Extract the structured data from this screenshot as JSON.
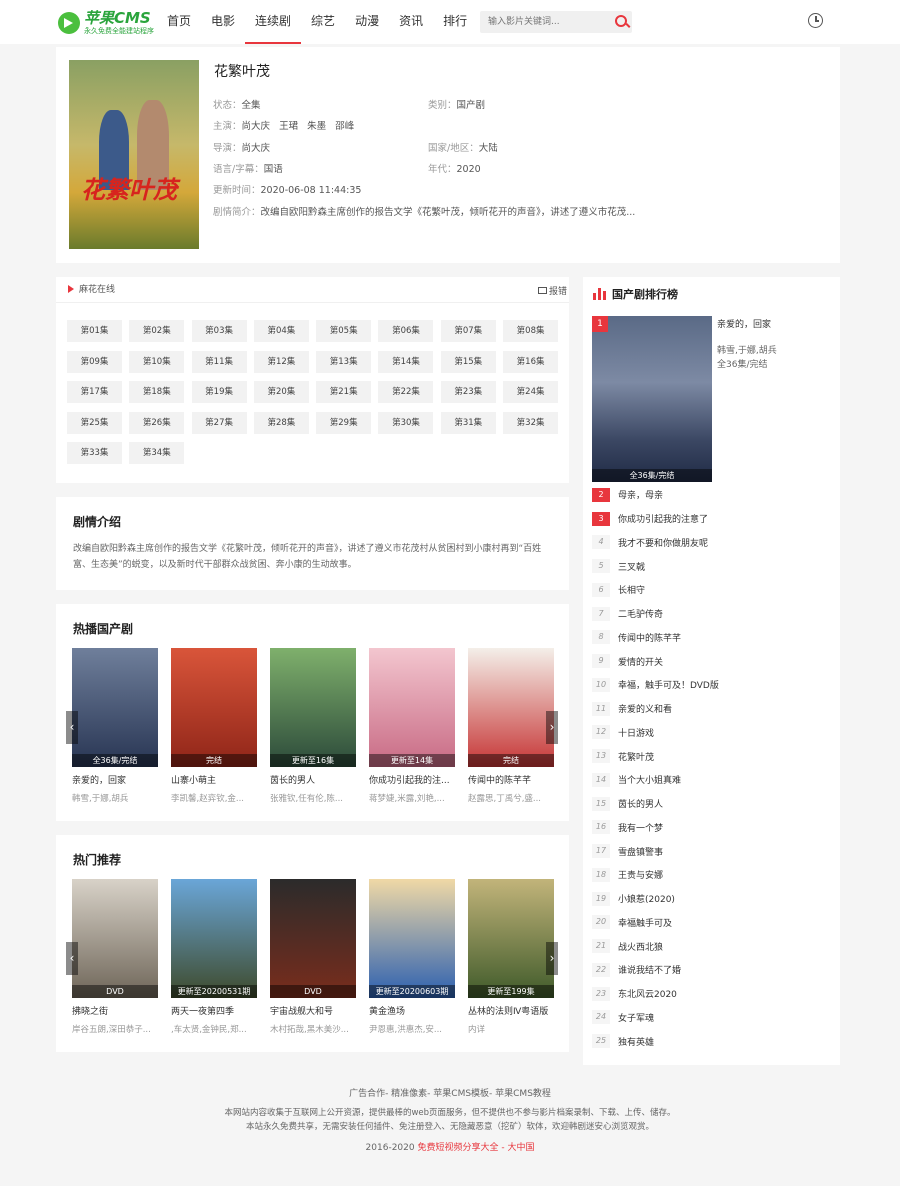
{
  "header": {
    "logo_name": "苹果CMS",
    "logo_slogan": "永久免费全能建站程序",
    "nav": [
      "首页",
      "电影",
      "连续剧",
      "综艺",
      "动漫",
      "资讯",
      "排行"
    ],
    "active_nav": 2,
    "search_placeholder": "输入影片关键词..."
  },
  "detail": {
    "title": "花繁叶茂",
    "poster_text": "花繁叶茂",
    "status_label": "状态：",
    "status": "全集",
    "category_label": "类别：",
    "category": "国产剧",
    "cast_label": "主演：",
    "cast": [
      "尚大庆",
      "王珺",
      "朱墨",
      "邵峰"
    ],
    "director_label": "导演：",
    "director": "尚大庆",
    "region_label": "国家/地区：",
    "region": "大陆",
    "language_label": "语言/字幕：",
    "language": "国语",
    "year_label": "年代：",
    "year": "2020",
    "updated_label": "更新时间：",
    "updated": "2020-06-08 11:44:35",
    "synopsis_label": "剧情简介：",
    "synopsis": "改编自欧阳黔森主席创作的报告文学《花繁叶茂，倾听花开的声音》，讲述了遵义市花茂..."
  },
  "player": {
    "tab_label": "麻花在线",
    "report_label": "报错",
    "episodes": [
      "第01集",
      "第02集",
      "第03集",
      "第04集",
      "第05集",
      "第06集",
      "第07集",
      "第08集",
      "第09集",
      "第10集",
      "第11集",
      "第12集",
      "第13集",
      "第14集",
      "第15集",
      "第16集",
      "第17集",
      "第18集",
      "第19集",
      "第20集",
      "第21集",
      "第22集",
      "第23集",
      "第24集",
      "第25集",
      "第26集",
      "第27集",
      "第28集",
      "第29集",
      "第30集",
      "第31集",
      "第32集",
      "第33集",
      "第34集"
    ]
  },
  "intro": {
    "title": "剧情介绍",
    "text": "改编自欧阳黔森主席创作的报告文学《花繁叶茂，倾听花开的声音》，讲述了遵义市花茂村从贫困村到小康村再到“百姓富、生态美”的蜕变，以及新时代干部群众战贫困、奔小康的生动故事。"
  },
  "hot": {
    "title": "热播国产剧",
    "items": [
      {
        "name": "亲爱的，回家",
        "cast": "韩雪,于娜,胡兵",
        "tag": "全36集/完结",
        "color1": "#6f7f9b",
        "color2": "#283553"
      },
      {
        "name": "山寨小萌主",
        "cast": "李凯馨,赵弈钦,金...",
        "tag": "完结",
        "color1": "#d9553a",
        "color2": "#8f2518"
      },
      {
        "name": "茵长的男人",
        "cast": "张雅钦,任有伦,陈...",
        "tag": "更新至16集",
        "color1": "#7fb06c",
        "color2": "#2c4a3a"
      },
      {
        "name": "你成功引起我的注...",
        "cast": "蒋梦婕,米露,刘艳,...",
        "tag": "更新至14集",
        "color1": "#f3c6cf",
        "color2": "#c86a84"
      },
      {
        "name": "传闻中的陈芊芊",
        "cast": "赵露思,丁禹兮,盛...",
        "tag": "完结",
        "color1": "#f4efe9",
        "color2": "#c63535"
      }
    ]
  },
  "recommend": {
    "title": "热门推荐",
    "items": [
      {
        "name": "拂晓之街",
        "cast": "岸谷五朗,深田恭子...",
        "tag": "DVD",
        "color1": "#d8d2c8",
        "color2": "#6e6558"
      },
      {
        "name": "两天一夜第四季",
        "cast": ",车太贤,金钟民,郑...",
        "tag": "更新至20200531期",
        "color1": "#6aa6d8",
        "color2": "#3e4a2b"
      },
      {
        "name": "宇宙战舰大和号",
        "cast": "木村拓哉,黑木美沙...",
        "tag": "DVD",
        "color1": "#2b2b2b",
        "color2": "#7a2d1c"
      },
      {
        "name": "黄金渔场",
        "cast": "尹恩惠,洪惠杰,安...",
        "tag": "更新至20200603期",
        "color1": "#f0d9a6",
        "color2": "#2b5fb0"
      },
      {
        "name": "丛林的法则Ⅳ粤语版",
        "cast": "内详",
        "tag": "更新至199集",
        "color1": "#c2b47a",
        "color2": "#3f5a2a"
      }
    ]
  },
  "rank": {
    "title": "国产剧排行榜",
    "top1": {
      "name": "亲爱的，回家",
      "cast": "韩雪,于娜,胡兵",
      "status": "全36集/完结",
      "tag": "全36集/完结"
    },
    "items": [
      "母亲，母亲",
      "你成功引起我的注意了",
      "我才不要和你做朋友呢",
      "三叉戟",
      "长相守",
      "二毛驴传奇",
      "传闻中的陈芊芊",
      "爱情的开关",
      "幸福，触手可及！DVD版",
      "亲爱的义和看",
      "十日游戏",
      "花繁叶茂",
      "当个大小姐真难",
      "茵长的男人",
      "我有一个梦",
      "雪盘镇警事",
      "王贵与安娜",
      "小娘惹(2020)",
      "幸福触手可及",
      "战火西北狼",
      "谁说我结不了婚",
      "东北风云2020",
      "女子军魂",
      "独有英雄"
    ]
  },
  "footer": {
    "line1": "广告合作- 精准像素- 苹果CMS模板- 苹果CMS教程",
    "line2": "本网站内容收集于互联网上公开资源，提供最棒的web页面服务，但不提供也不参与影片档案录制、下载、上传、储存。",
    "line3": "本站永久免费共享，无需安装任何插件、免注册登入、无隐藏恶意（挖矿）软体，欢迎韩剧迷安心浏览观赏。",
    "line4_pre": "2016-2020 ",
    "line4_red": "免费短视频分享大全 - 大中国"
  }
}
